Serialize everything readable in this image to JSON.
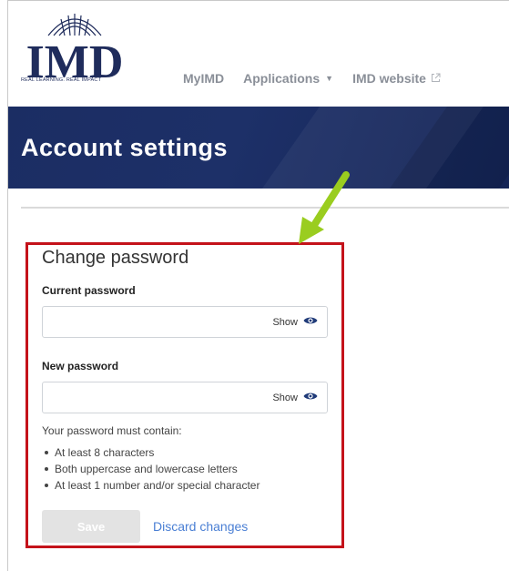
{
  "header": {
    "logo_text": "IMD",
    "logo_tagline": "REAL LEARNING. REAL IMPACT",
    "nav": [
      {
        "label": "MyIMD"
      },
      {
        "label": "Applications"
      },
      {
        "label": "IMD website"
      }
    ]
  },
  "banner": {
    "title": "Account settings"
  },
  "form": {
    "title": "Change password",
    "current_password": {
      "label": "Current password",
      "value": "",
      "show_label": "Show"
    },
    "new_password": {
      "label": "New password",
      "value": "",
      "show_label": "Show"
    },
    "requirements_intro": "Your password must contain:",
    "requirements": [
      "At least 8 characters",
      "Both uppercase and lowercase letters",
      "At least 1 number and/or special character"
    ],
    "save_label": "Save",
    "discard_label": "Discard changes"
  },
  "colors": {
    "brand_navy": "#1b2d63",
    "highlight_red": "#c4121a",
    "annotation_arrow": "#9acd1f",
    "link_blue": "#4a7fd4"
  },
  "icons": [
    "imd-logo-icon",
    "chevron-down-icon",
    "external-link-icon",
    "eye-icon",
    "annotation-arrow-icon"
  ]
}
